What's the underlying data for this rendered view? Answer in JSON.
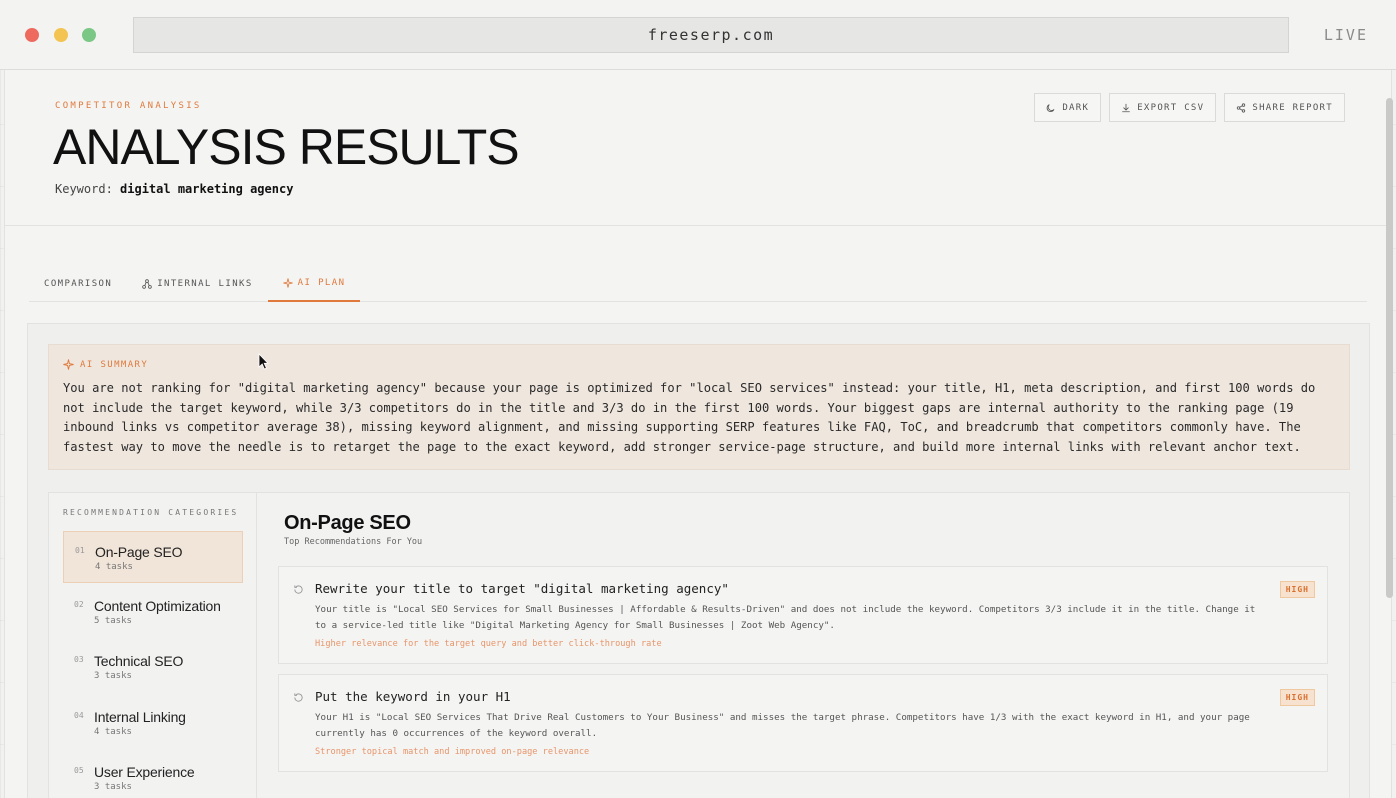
{
  "browser": {
    "url": "freeserp.com",
    "status": "LIVE"
  },
  "header": {
    "eyebrow": "COMPETITOR ANALYSIS",
    "title": "ANALYSIS RESULTS",
    "keyword_label": "Keyword:",
    "keyword_value": "digital marketing agency",
    "actions": {
      "dark": "DARK",
      "export": "EXPORT CSV",
      "share": "SHARE REPORT"
    }
  },
  "tabs": [
    {
      "label": "COMPARISON",
      "icon": "none",
      "active": false
    },
    {
      "label": "INTERNAL LINKS",
      "icon": "network-icon",
      "active": false
    },
    {
      "label": "AI PLAN",
      "icon": "sparkle-icon",
      "active": true
    }
  ],
  "summary": {
    "label": "AI SUMMARY",
    "text": "You are not ranking for \"digital marketing agency\" because your page is optimized for \"local SEO services\" instead: your title, H1, meta description, and first 100 words do not include the target keyword, while 3/3 competitors do in the title and 3/3 do in the first 100 words. Your biggest gaps are internal authority to the ranking page (19 inbound links vs competitor average 38), missing keyword alignment, and missing supporting SERP features like FAQ, ToC, and breadcrumb that competitors commonly have. The fastest way to move the needle is to retarget the page to the exact keyword, add stronger service-page structure, and build more internal links with relevant anchor text."
  },
  "categories": {
    "label": "RECOMMENDATION CATEGORIES",
    "items": [
      {
        "num": "01",
        "name": "On-Page SEO",
        "count": "4 tasks",
        "active": true
      },
      {
        "num": "02",
        "name": "Content Optimization",
        "count": "5 tasks",
        "active": false
      },
      {
        "num": "03",
        "name": "Technical SEO",
        "count": "3 tasks",
        "active": false
      },
      {
        "num": "04",
        "name": "Internal Linking",
        "count": "4 tasks",
        "active": false
      },
      {
        "num": "05",
        "name": "User Experience",
        "count": "3 tasks",
        "active": false
      }
    ]
  },
  "main": {
    "title": "On-Page SEO",
    "subtitle": "Top Recommendations For You",
    "recommendations": [
      {
        "title": "Rewrite your title to target \"digital marketing agency\"",
        "description": "Your title is \"Local SEO Services for Small Businesses | Affordable & Results-Driven\" and does not include the keyword. Competitors 3/3 include it in the title. Change it to a service-led title like \"Digital Marketing Agency for Small Businesses | Zoot Web Agency\".",
        "impact": "Higher relevance for the target query and better click-through rate",
        "priority": "HIGH"
      },
      {
        "title": "Put the keyword in your H1",
        "description": "Your H1 is \"Local SEO Services That Drive Real Customers to Your Business\" and misses the target phrase. Competitors have 1/3 with the exact keyword in H1, and your page currently has 0 occurrences of the keyword overall.",
        "impact": "Stronger topical match and improved on-page relevance",
        "priority": "HIGH"
      }
    ]
  },
  "colors": {
    "accent": "#e07a3c",
    "summary_bg": "#efe6de",
    "badge_bg": "#f6e2cf"
  }
}
